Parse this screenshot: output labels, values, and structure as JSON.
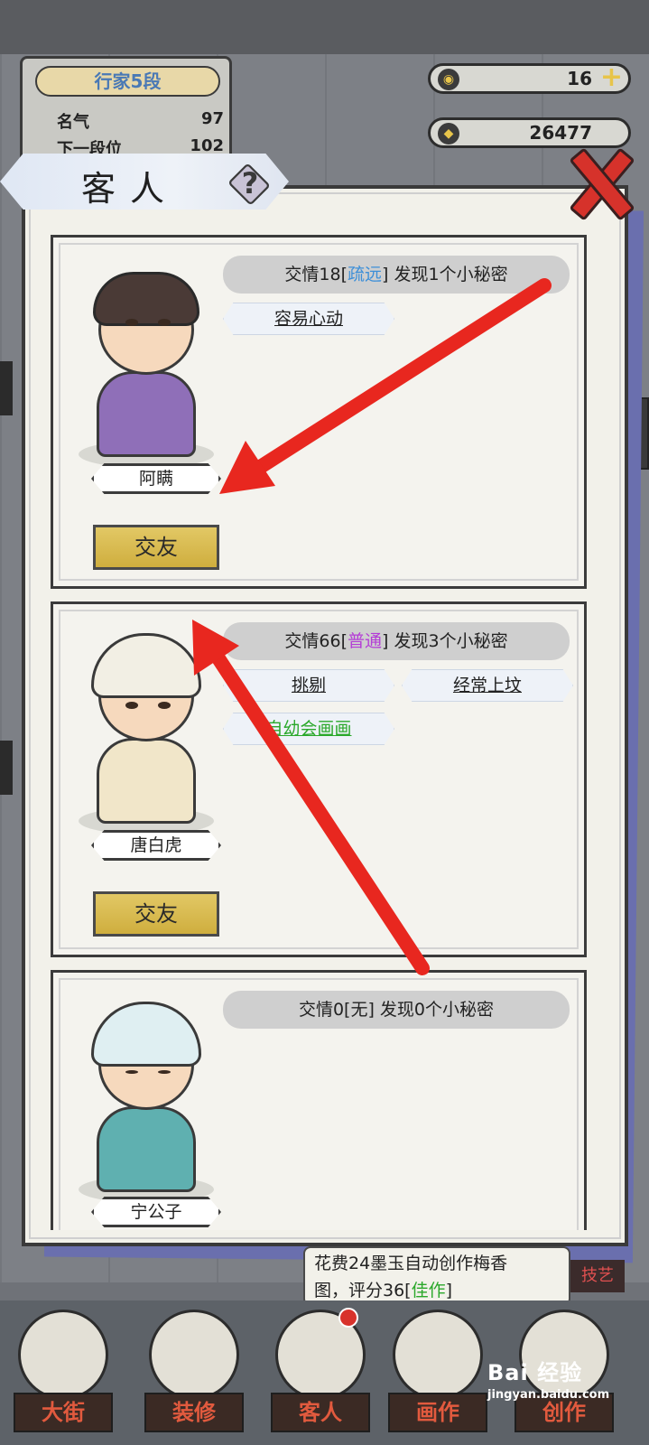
{
  "rank": {
    "title": "行家5段",
    "fame_label": "名气",
    "fame_value": "97",
    "next_label": "下一段位",
    "next_value": "102"
  },
  "resources": {
    "jade": "16",
    "coins": "26477"
  },
  "dialog": {
    "title": "客人",
    "help": "?"
  },
  "guests": [
    {
      "name": "阿瞒",
      "friendship_prefix": "交情18[",
      "level": "疏远",
      "friendship_suffix": "] 发现1个小秘密",
      "tags": [
        "容易心动"
      ],
      "button": "交友"
    },
    {
      "name": "唐白虎",
      "friendship_prefix": "交情66[",
      "level": "普通",
      "friendship_suffix": "] 发现3个小秘密",
      "tags": [
        "挑剔",
        "经常上坟",
        "自幼会画画"
      ],
      "button": "交友"
    },
    {
      "name": "宁公子",
      "friendship_prefix": "交情0[",
      "level": "无",
      "friendship_suffix": "] 发现0个小秘密",
      "tags": []
    }
  ],
  "bottom_note": {
    "line1": "花费24墨玉自动创作梅香",
    "line2_prefix": "图，评分36[",
    "line2_level": "佳作",
    "line2_suffix": "]"
  },
  "side_tag": "技艺",
  "nav": [
    "大街",
    "装修",
    "客人",
    "画作",
    "创作"
  ],
  "watermark": {
    "logo": "Bai 经验",
    "site": "jingyan.baidu.com"
  },
  "colors": {
    "level_far": "#3d8fd8",
    "level_normal": "#b43dd6",
    "tag_link": "#2aa82a",
    "button": "#d6b84a",
    "close": "#d6322b",
    "arrow": "#e8271f"
  }
}
